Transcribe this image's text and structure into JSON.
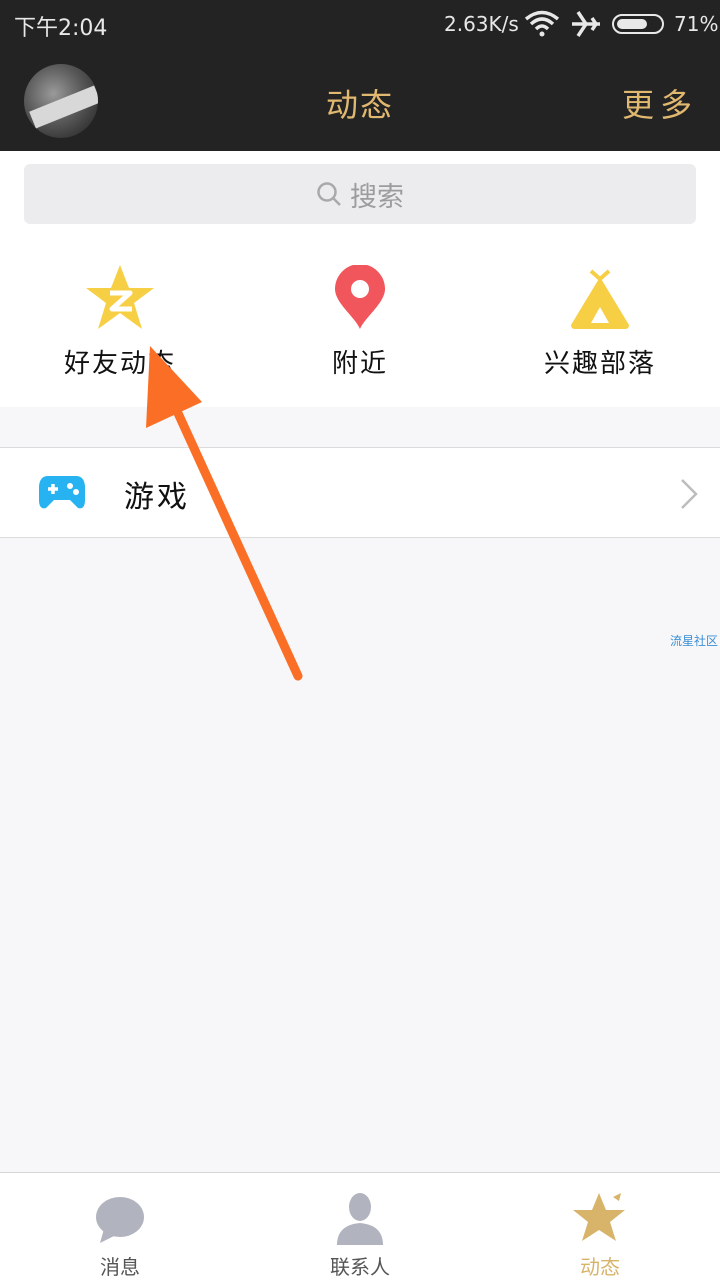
{
  "status_bar": {
    "time": "下午2:04",
    "network_speed": "2.63K/s",
    "battery_text": "71%",
    "battery_level": 0.71
  },
  "header": {
    "title": "动态",
    "more_label": "更多",
    "accent_color": "#e0b870"
  },
  "search": {
    "placeholder": "搜索"
  },
  "entries": [
    {
      "label": "好友动态",
      "icon": "qzone-star-icon",
      "color": "#f7cf45"
    },
    {
      "label": "附近",
      "icon": "location-pin-icon",
      "color": "#f0565b"
    },
    {
      "label": "兴趣部落",
      "icon": "tribe-tent-icon",
      "color": "#f7cf45"
    }
  ],
  "list": [
    {
      "label": "游戏",
      "icon": "gamepad-icon",
      "color": "#27b3f2"
    }
  ],
  "watermark": "流星社区",
  "annotation": {
    "arrow_color": "#fa6f25"
  },
  "tabbar": {
    "tabs": [
      {
        "label": "消息",
        "icon": "message-bubble-icon"
      },
      {
        "label": "联系人",
        "icon": "contact-person-icon"
      },
      {
        "label": "动态",
        "icon": "feed-star-icon",
        "active": true
      }
    ],
    "active_color": "#d7b46a"
  }
}
